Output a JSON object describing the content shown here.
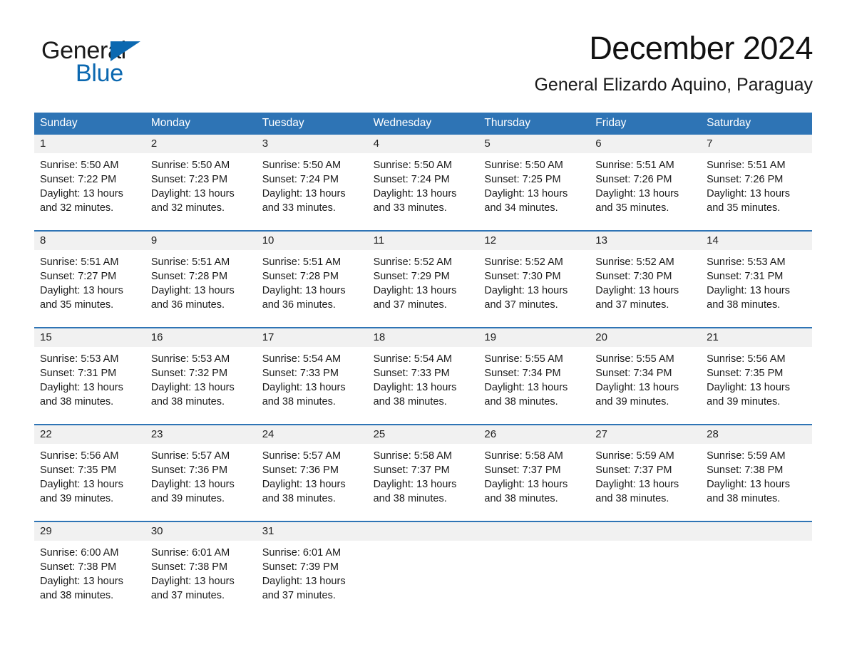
{
  "brand": {
    "name_part1": "General",
    "name_part2": "Blue",
    "triangle_color": "#0b68b0"
  },
  "header": {
    "month_title": "December 2024",
    "location": "General Elizardo Aquino, Paraguay"
  },
  "theme": {
    "header_blue": "#2e74b5",
    "daynum_band": "#f1f1f1",
    "text": "#1a1a1a"
  },
  "weekdays": [
    "Sunday",
    "Monday",
    "Tuesday",
    "Wednesday",
    "Thursday",
    "Friday",
    "Saturday"
  ],
  "labels": {
    "sunrise_prefix": "Sunrise:",
    "sunset_prefix": "Sunset:",
    "daylight_prefix": "Daylight:"
  },
  "weeks": [
    [
      {
        "day": "1",
        "sunrise": "Sunrise: 5:50 AM",
        "sunset": "Sunset: 7:22 PM",
        "daylight_1": "Daylight: 13 hours",
        "daylight_2": "and 32 minutes."
      },
      {
        "day": "2",
        "sunrise": "Sunrise: 5:50 AM",
        "sunset": "Sunset: 7:23 PM",
        "daylight_1": "Daylight: 13 hours",
        "daylight_2": "and 32 minutes."
      },
      {
        "day": "3",
        "sunrise": "Sunrise: 5:50 AM",
        "sunset": "Sunset: 7:24 PM",
        "daylight_1": "Daylight: 13 hours",
        "daylight_2": "and 33 minutes."
      },
      {
        "day": "4",
        "sunrise": "Sunrise: 5:50 AM",
        "sunset": "Sunset: 7:24 PM",
        "daylight_1": "Daylight: 13 hours",
        "daylight_2": "and 33 minutes."
      },
      {
        "day": "5",
        "sunrise": "Sunrise: 5:50 AM",
        "sunset": "Sunset: 7:25 PM",
        "daylight_1": "Daylight: 13 hours",
        "daylight_2": "and 34 minutes."
      },
      {
        "day": "6",
        "sunrise": "Sunrise: 5:51 AM",
        "sunset": "Sunset: 7:26 PM",
        "daylight_1": "Daylight: 13 hours",
        "daylight_2": "and 35 minutes."
      },
      {
        "day": "7",
        "sunrise": "Sunrise: 5:51 AM",
        "sunset": "Sunset: 7:26 PM",
        "daylight_1": "Daylight: 13 hours",
        "daylight_2": "and 35 minutes."
      }
    ],
    [
      {
        "day": "8",
        "sunrise": "Sunrise: 5:51 AM",
        "sunset": "Sunset: 7:27 PM",
        "daylight_1": "Daylight: 13 hours",
        "daylight_2": "and 35 minutes."
      },
      {
        "day": "9",
        "sunrise": "Sunrise: 5:51 AM",
        "sunset": "Sunset: 7:28 PM",
        "daylight_1": "Daylight: 13 hours",
        "daylight_2": "and 36 minutes."
      },
      {
        "day": "10",
        "sunrise": "Sunrise: 5:51 AM",
        "sunset": "Sunset: 7:28 PM",
        "daylight_1": "Daylight: 13 hours",
        "daylight_2": "and 36 minutes."
      },
      {
        "day": "11",
        "sunrise": "Sunrise: 5:52 AM",
        "sunset": "Sunset: 7:29 PM",
        "daylight_1": "Daylight: 13 hours",
        "daylight_2": "and 37 minutes."
      },
      {
        "day": "12",
        "sunrise": "Sunrise: 5:52 AM",
        "sunset": "Sunset: 7:30 PM",
        "daylight_1": "Daylight: 13 hours",
        "daylight_2": "and 37 minutes."
      },
      {
        "day": "13",
        "sunrise": "Sunrise: 5:52 AM",
        "sunset": "Sunset: 7:30 PM",
        "daylight_1": "Daylight: 13 hours",
        "daylight_2": "and 37 minutes."
      },
      {
        "day": "14",
        "sunrise": "Sunrise: 5:53 AM",
        "sunset": "Sunset: 7:31 PM",
        "daylight_1": "Daylight: 13 hours",
        "daylight_2": "and 38 minutes."
      }
    ],
    [
      {
        "day": "15",
        "sunrise": "Sunrise: 5:53 AM",
        "sunset": "Sunset: 7:31 PM",
        "daylight_1": "Daylight: 13 hours",
        "daylight_2": "and 38 minutes."
      },
      {
        "day": "16",
        "sunrise": "Sunrise: 5:53 AM",
        "sunset": "Sunset: 7:32 PM",
        "daylight_1": "Daylight: 13 hours",
        "daylight_2": "and 38 minutes."
      },
      {
        "day": "17",
        "sunrise": "Sunrise: 5:54 AM",
        "sunset": "Sunset: 7:33 PM",
        "daylight_1": "Daylight: 13 hours",
        "daylight_2": "and 38 minutes."
      },
      {
        "day": "18",
        "sunrise": "Sunrise: 5:54 AM",
        "sunset": "Sunset: 7:33 PM",
        "daylight_1": "Daylight: 13 hours",
        "daylight_2": "and 38 minutes."
      },
      {
        "day": "19",
        "sunrise": "Sunrise: 5:55 AM",
        "sunset": "Sunset: 7:34 PM",
        "daylight_1": "Daylight: 13 hours",
        "daylight_2": "and 38 minutes."
      },
      {
        "day": "20",
        "sunrise": "Sunrise: 5:55 AM",
        "sunset": "Sunset: 7:34 PM",
        "daylight_1": "Daylight: 13 hours",
        "daylight_2": "and 39 minutes."
      },
      {
        "day": "21",
        "sunrise": "Sunrise: 5:56 AM",
        "sunset": "Sunset: 7:35 PM",
        "daylight_1": "Daylight: 13 hours",
        "daylight_2": "and 39 minutes."
      }
    ],
    [
      {
        "day": "22",
        "sunrise": "Sunrise: 5:56 AM",
        "sunset": "Sunset: 7:35 PM",
        "daylight_1": "Daylight: 13 hours",
        "daylight_2": "and 39 minutes."
      },
      {
        "day": "23",
        "sunrise": "Sunrise: 5:57 AM",
        "sunset": "Sunset: 7:36 PM",
        "daylight_1": "Daylight: 13 hours",
        "daylight_2": "and 39 minutes."
      },
      {
        "day": "24",
        "sunrise": "Sunrise: 5:57 AM",
        "sunset": "Sunset: 7:36 PM",
        "daylight_1": "Daylight: 13 hours",
        "daylight_2": "and 38 minutes."
      },
      {
        "day": "25",
        "sunrise": "Sunrise: 5:58 AM",
        "sunset": "Sunset: 7:37 PM",
        "daylight_1": "Daylight: 13 hours",
        "daylight_2": "and 38 minutes."
      },
      {
        "day": "26",
        "sunrise": "Sunrise: 5:58 AM",
        "sunset": "Sunset: 7:37 PM",
        "daylight_1": "Daylight: 13 hours",
        "daylight_2": "and 38 minutes."
      },
      {
        "day": "27",
        "sunrise": "Sunrise: 5:59 AM",
        "sunset": "Sunset: 7:37 PM",
        "daylight_1": "Daylight: 13 hours",
        "daylight_2": "and 38 minutes."
      },
      {
        "day": "28",
        "sunrise": "Sunrise: 5:59 AM",
        "sunset": "Sunset: 7:38 PM",
        "daylight_1": "Daylight: 13 hours",
        "daylight_2": "and 38 minutes."
      }
    ],
    [
      {
        "day": "29",
        "sunrise": "Sunrise: 6:00 AM",
        "sunset": "Sunset: 7:38 PM",
        "daylight_1": "Daylight: 13 hours",
        "daylight_2": "and 38 minutes."
      },
      {
        "day": "30",
        "sunrise": "Sunrise: 6:01 AM",
        "sunset": "Sunset: 7:38 PM",
        "daylight_1": "Daylight: 13 hours",
        "daylight_2": "and 37 minutes."
      },
      {
        "day": "31",
        "sunrise": "Sunrise: 6:01 AM",
        "sunset": "Sunset: 7:39 PM",
        "daylight_1": "Daylight: 13 hours",
        "daylight_2": "and 37 minutes."
      },
      {
        "day": "",
        "sunrise": "",
        "sunset": "",
        "daylight_1": "",
        "daylight_2": ""
      },
      {
        "day": "",
        "sunrise": "",
        "sunset": "",
        "daylight_1": "",
        "daylight_2": ""
      },
      {
        "day": "",
        "sunrise": "",
        "sunset": "",
        "daylight_1": "",
        "daylight_2": ""
      },
      {
        "day": "",
        "sunrise": "",
        "sunset": "",
        "daylight_1": "",
        "daylight_2": ""
      }
    ]
  ]
}
